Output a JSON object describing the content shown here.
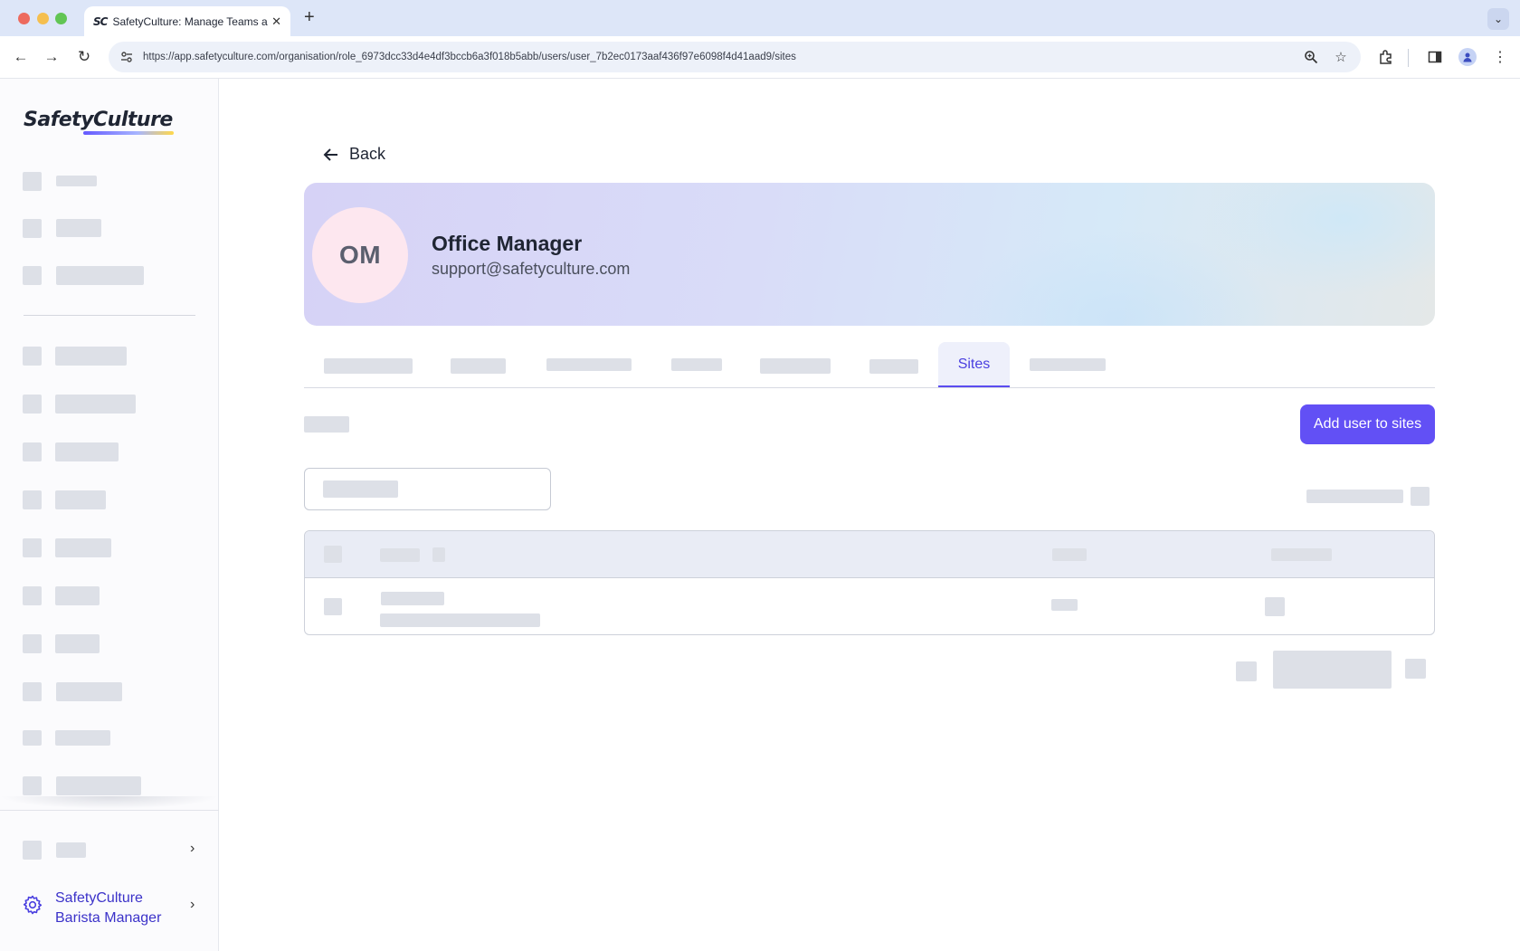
{
  "browser": {
    "tab_title": "SafetyCulture: Manage Teams and...",
    "tab_favicon": "SC",
    "url": "https://app.safetyculture.com/organisation/role_6973dcc33d4e4df3bccb6a3f018b5abb/users/user_7b2ec0173aaf436f97e6098f4d41aad9/sites"
  },
  "sidebar": {
    "logo": "SafetyCulture",
    "org_line1": "SafetyCulture",
    "org_line2": "Barista Manager"
  },
  "main": {
    "back_label": "Back",
    "profile": {
      "initials": "OM",
      "name": "Office Manager",
      "email": "support@safetyculture.com"
    },
    "active_tab": "Sites",
    "add_button": "Add user to sites"
  },
  "colors": {
    "accent": "#6250f5",
    "accent_text": "#4a3fe0",
    "avatar_bg": "#fde7ef",
    "skeleton": "#dde0e7"
  },
  "icons": [
    "back-arrow-icon",
    "gear-icon",
    "chevron-right-icon",
    "search-icon",
    "star-icon",
    "extensions-icon",
    "profile-icon"
  ]
}
